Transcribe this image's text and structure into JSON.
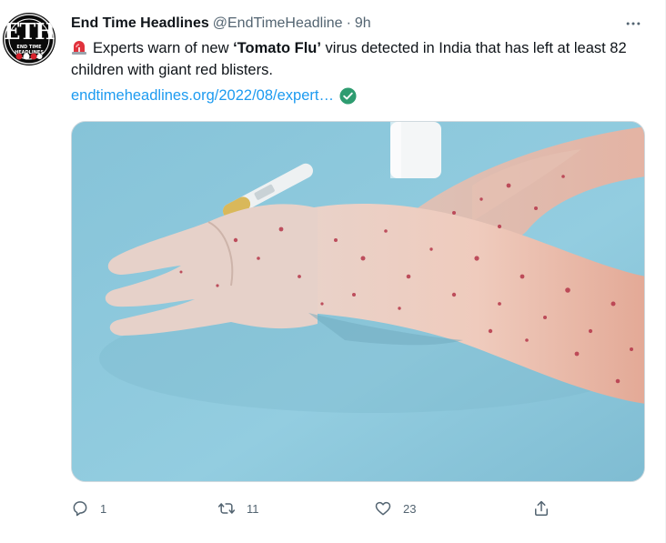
{
  "tweet": {
    "author_name": "End Time Headlines",
    "handle": "@EndTimeHeadline",
    "separator": "·",
    "time": "9h",
    "avatar": {
      "logo_text": "ETH",
      "logo_subtext": "END TIME HEADLINES"
    },
    "text": {
      "prefix": "Experts warn of new ",
      "quoted_open": "‘",
      "highlight": "Tomato Flu",
      "quoted_close": "’",
      "suffix": " virus detected in India that has left at least 82 children with giant red blisters."
    },
    "link": "endtimeheadlines.org/2022/08/expert…",
    "icons": {
      "siren": "rotating-light-icon",
      "verified": "check-circle-icon",
      "more": "more-horizontal-icon"
    },
    "media": {
      "description": "Photo of a child's hand and arms covered in red blisters on a light blue surface, with a thermometer and white bottle in the background"
    },
    "actions": {
      "reply_count": "1",
      "retweet_count": "11",
      "like_count": "23"
    }
  },
  "colors": {
    "accent": "#1d9bf0",
    "verified": "#2e9c70",
    "muted": "#536471",
    "text": "#0f1419"
  }
}
